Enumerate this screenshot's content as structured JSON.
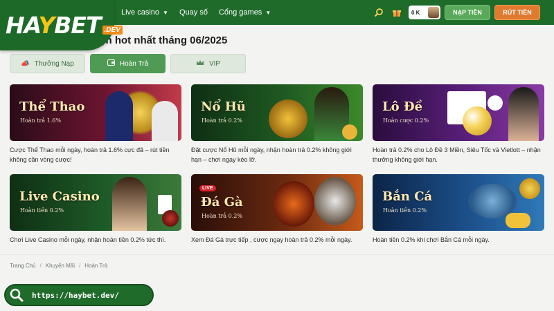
{
  "header": {
    "logo": {
      "main": "HAYBET",
      "suffix": ".DEV"
    },
    "nav": [
      {
        "label": "Live casino",
        "has_dropdown": true
      },
      {
        "label": "Quay số",
        "has_dropdown": false
      },
      {
        "label": "Cổng games",
        "has_dropdown": true
      }
    ],
    "balance": "0 K",
    "deposit_label": "NẠP TIỀN",
    "withdraw_label": "RÚT TIỀN",
    "icons": [
      "search-icon",
      "gift-icon",
      "avatar"
    ]
  },
  "page_title": "iện hot nhất tháng 06/2025",
  "tabs": [
    {
      "label": "Thưởng Nạp",
      "icon": "megaphone-icon",
      "active": false
    },
    {
      "label": "Hoàn Trả",
      "icon": "wallet-icon",
      "active": true
    },
    {
      "label": "VIP",
      "icon": "crown-icon",
      "active": false
    }
  ],
  "cards": [
    {
      "title": "Thể Thao",
      "subtitle": "Hoàn trả 1.6%",
      "description": "Cược Thể Thao mỗi ngày, hoàn trả 1.6% cực đã – rút tiền không cần vòng cược!"
    },
    {
      "title": "Nổ Hũ",
      "subtitle": "Hoàn trả 0.2%",
      "description": "Đặt cược Nổ Hũ mỗi ngày, nhận hoàn trả 0.2% không giới hạn – chơi ngay kẻo lỡ."
    },
    {
      "title": "Lô Đề",
      "subtitle": "Hoàn cược 0.2%",
      "description": "Hoàn trả 0.2% cho Lô Đề 3 Miền, Siêu Tốc và Vietlott – nhận thưởng không giới hạn."
    },
    {
      "title": "Live Casino",
      "subtitle": "Hoàn tiền 0.2%",
      "description": "Chơi Live Casino mỗi ngày, nhận hoàn tiền 0.2% tức thì."
    },
    {
      "title": "Đá Gà",
      "subtitle": "Hoàn trả 0.2%",
      "badge": "LIVE",
      "description": "Xem Đá Gà trực tiếp , cược ngay hoàn trả 0.2% mỗi ngày."
    },
    {
      "title": "Bắn Cá",
      "subtitle": "Hoàn tiền 0.2%",
      "description": "Hoàn tiền 0.2% khi chơi Bắn Cá mỗi ngày."
    }
  ],
  "breadcrumb": [
    "Trang Chủ",
    "Khuyến Mãi",
    "Hoàn Trả"
  ],
  "url_pill": "https://haybet.dev/",
  "colors": {
    "brand_green": "#1f6b2a",
    "active_tab": "#4f9a55",
    "deposit": "#5aa85a",
    "withdraw": "#e07a2e"
  }
}
